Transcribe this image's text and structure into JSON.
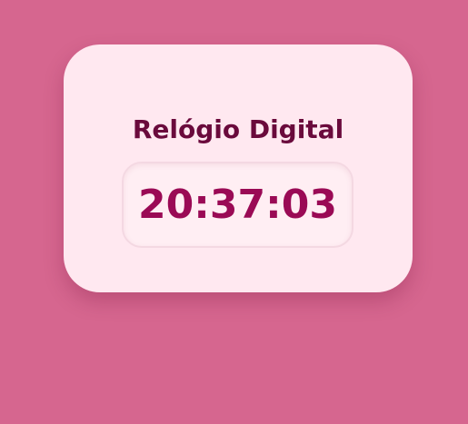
{
  "colors": {
    "background": "#d6668f",
    "card": "#ffe8f0",
    "title": "#6a0a3c",
    "time": "#9a0a55"
  },
  "clock": {
    "title": "Relógio Digital",
    "time": "20:37:03"
  }
}
